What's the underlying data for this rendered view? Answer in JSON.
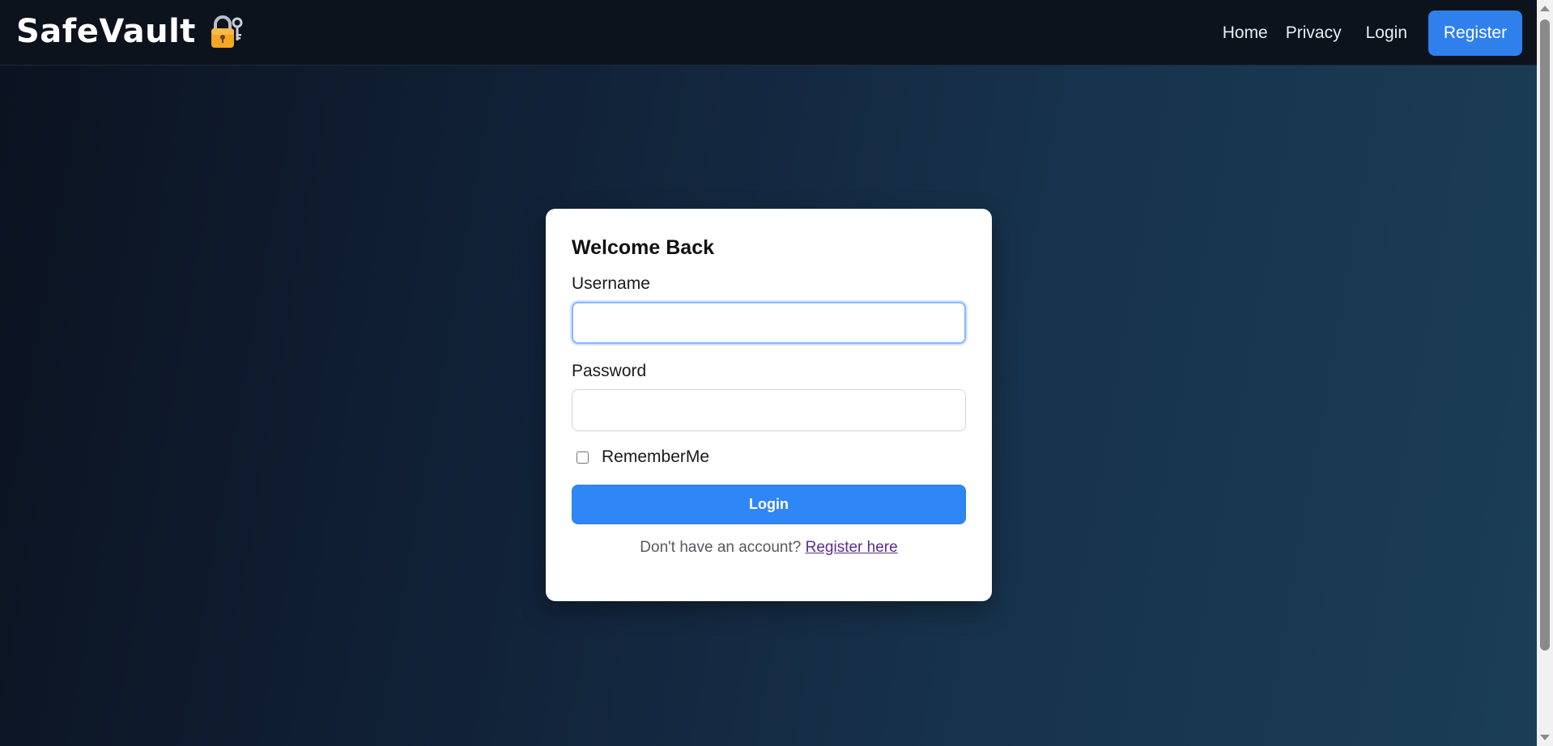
{
  "navbar": {
    "brand": "SafeVault",
    "brand_icon": "lock-with-key-icon",
    "links": {
      "home": "Home",
      "privacy": "Privacy",
      "login": "Login",
      "register": "Register"
    },
    "colors": {
      "background": "#0d131c",
      "register_button": "#2f80ed"
    }
  },
  "login_card": {
    "title": "Welcome Back",
    "username_label": "Username",
    "username_value": "",
    "password_label": "Password",
    "password_value": "",
    "remember_label": "RememberMe",
    "remember_checked": false,
    "login_button": "Login",
    "signup_prompt": "Don't have an account?",
    "signup_link": "Register here",
    "colors": {
      "primary_button": "#2f86f6",
      "link": "#5a2d91"
    }
  }
}
